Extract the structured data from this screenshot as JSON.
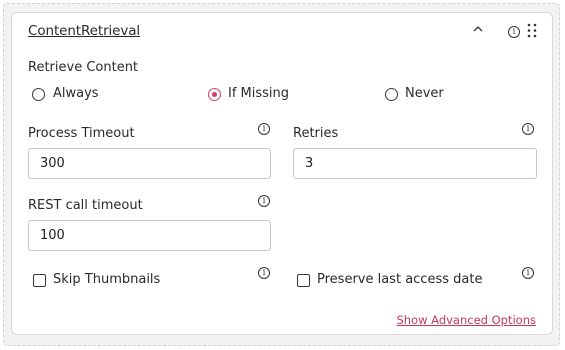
{
  "header": {
    "title": "ContentRetrieval",
    "collapse_icon": "chevron-up-icon",
    "info_icon": "info-icon",
    "drag_icon": "drag-handle-icon"
  },
  "retrieve": {
    "label": "Retrieve Content",
    "options": [
      "Always",
      "If Missing",
      "Never"
    ],
    "selected": "If Missing"
  },
  "fields": {
    "process_timeout": {
      "label": "Process Timeout",
      "value": "300"
    },
    "retries": {
      "label": "Retries",
      "value": "3"
    },
    "rest_timeout": {
      "label": "REST call timeout",
      "value": "100"
    }
  },
  "checkboxes": {
    "skip_thumbnails": {
      "label": "Skip Thumbnails",
      "checked": false
    },
    "preserve_access": {
      "label": "Preserve last access date",
      "checked": false
    }
  },
  "advanced_link": "Show Advanced Options",
  "colors": {
    "accent": "#d93a64",
    "link": "#c8385e"
  }
}
